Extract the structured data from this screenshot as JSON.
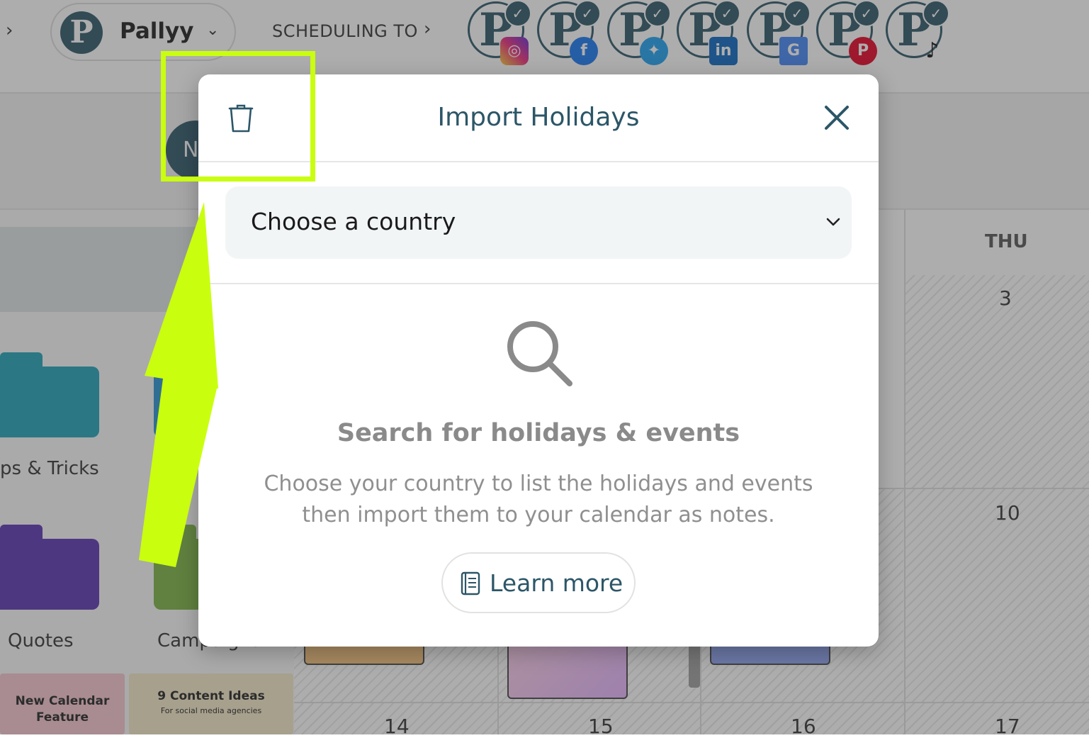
{
  "topbar": {
    "brand_name": "Pallyy",
    "brand_logo_letter": "P",
    "scheduling_label": "SCHEDULING TO",
    "accounts": [
      {
        "letter": "P",
        "network": "instagram-icon",
        "color": "#e1306c"
      },
      {
        "letter": "P",
        "network": "facebook-icon",
        "color": "#1877f2"
      },
      {
        "letter": "P",
        "network": "twitter-icon",
        "color": "#1da1f2"
      },
      {
        "letter": "P",
        "network": "linkedin-icon",
        "color": "#0a66c2"
      },
      {
        "letter": "P",
        "network": "google-business-icon",
        "color": "#4285f4"
      },
      {
        "letter": "P",
        "network": "pinterest-icon",
        "color": "#e60023"
      },
      {
        "letter": "P",
        "network": "tiktok-icon",
        "color": "#111111"
      }
    ]
  },
  "user_avatar_letter": "N",
  "left_panel": {
    "folders": [
      {
        "label": "ps & Tricks",
        "color": "#1fa3b8"
      },
      {
        "label": "Quotes",
        "color": "#5b34b1"
      },
      {
        "label": "Campaigns",
        "color": "#7ab342"
      }
    ],
    "thumbnails": [
      {
        "title": "New Calendar Feature"
      },
      {
        "title": "9 Content Ideas",
        "subtitle": "For social media agencies"
      }
    ]
  },
  "calendar": {
    "day_header": "THU",
    "day_numbers": [
      "3",
      "10",
      "14",
      "15",
      "16",
      "17"
    ]
  },
  "modal": {
    "title": "Import Holidays",
    "country_placeholder": "Choose a country",
    "empty_title": "Search for holidays & events",
    "empty_description": "Choose your country to list the holidays and events then import them to your calendar as notes.",
    "learn_more_label": "Learn more"
  },
  "colors": {
    "brand": "#2c5668",
    "highlight": "#c9ff0e",
    "muted_text": "#8f8f8f"
  }
}
